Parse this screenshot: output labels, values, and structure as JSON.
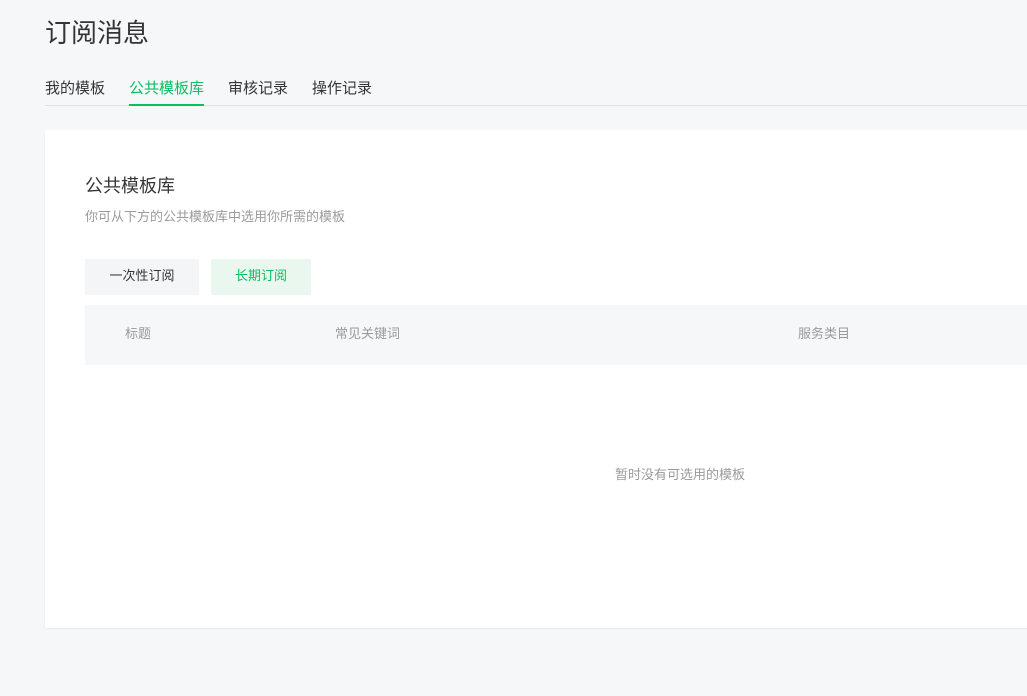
{
  "header": {
    "title": "订阅消息"
  },
  "tabs": [
    {
      "label": "我的模板",
      "active": false
    },
    {
      "label": "公共模板库",
      "active": true
    },
    {
      "label": "审核记录",
      "active": false
    },
    {
      "label": "操作记录",
      "active": false
    }
  ],
  "main": {
    "title": "公共模板库",
    "description": "你可从下方的公共模板库中选用你所需的模板",
    "subscription_types": [
      {
        "label": "一次性订阅",
        "selected": false
      },
      {
        "label": "长期订阅",
        "selected": true
      }
    ],
    "table": {
      "columns": [
        "标题",
        "常见关键词",
        "服务类目"
      ],
      "rows": [],
      "empty_text": "暂时没有可选用的模板"
    }
  },
  "colors": {
    "accent": "#07c160",
    "accent_bg": "#e9f7ef",
    "page_bg": "#f6f7f9",
    "muted_text": "#9a9a9a"
  }
}
